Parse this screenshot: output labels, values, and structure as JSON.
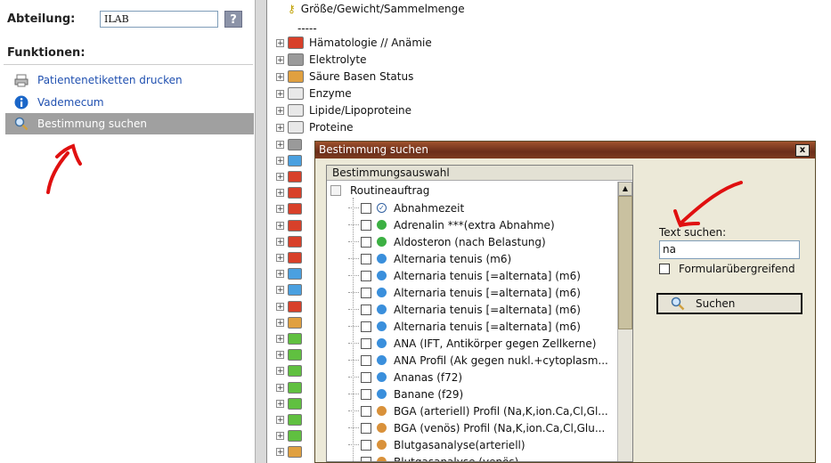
{
  "left_panel": {
    "abteilung_label": "Abteilung:",
    "abteilung_value": "ILAB",
    "help_label": "?",
    "funktionen_label": "Funktionen:",
    "items": [
      {
        "label": "Patientenetiketten drucken",
        "icon": "printer-icon"
      },
      {
        "label": "Vademecum",
        "icon": "info-icon"
      },
      {
        "label": "Bestimmung suchen",
        "icon": "search-icon",
        "active": true
      }
    ]
  },
  "tree": {
    "top_partial": "Größe/Gewicht/Sammelmenge",
    "dashes": "-----",
    "nodes": [
      {
        "label": "Hämatologie // Anämie",
        "color": "#d8402a"
      },
      {
        "label": "Elektrolyte",
        "color": "#9a9a9a"
      },
      {
        "label": "Säure Basen Status",
        "color": "#e0a040"
      },
      {
        "label": "Enzyme",
        "color": "#e8e8e8"
      },
      {
        "label": "Lipide/Lipoproteine",
        "color": "#e8e8e8"
      },
      {
        "label": "Proteine",
        "color": "#e8e8e8"
      }
    ],
    "side_icon_colors": [
      "#9a9a9a",
      "#4aa0e0",
      "#d8402a",
      "#d8402a",
      "#d8402a",
      "#d8402a",
      "#d8402a",
      "#d8402a",
      "#4aa0e0",
      "#4aa0e0",
      "#d8402a",
      "#e0a040",
      "#60c040",
      "#60c040",
      "#60c040",
      "#60c040",
      "#60c040",
      "#60c040",
      "#60c040",
      "#e0a040"
    ]
  },
  "dialog": {
    "title": "Bestimmung suchen",
    "close_label": "x",
    "list_header": "Bestimmungsauswahl",
    "root_label": "Routineauftrag",
    "rows": [
      {
        "label": "Abnahmezeit",
        "icon": "clock"
      },
      {
        "label": "Adrenalin ***(extra Abnahme)",
        "icon": "green"
      },
      {
        "label": "Aldosteron (nach Belastung)",
        "icon": "green"
      },
      {
        "label": "Alternaria tenuis (m6)",
        "icon": "blue"
      },
      {
        "label": "Alternaria tenuis [=alternata] (m6)",
        "icon": "blue"
      },
      {
        "label": "Alternaria tenuis [=alternata] (m6)",
        "icon": "blue"
      },
      {
        "label": "Alternaria tenuis [=alternata] (m6)",
        "icon": "blue"
      },
      {
        "label": "Alternaria tenuis [=alternata] (m6)",
        "icon": "blue"
      },
      {
        "label": "ANA (IFT, Antikörper gegen Zellkerne)",
        "icon": "blue"
      },
      {
        "label": "ANA Profil (Ak gegen nukl.+cytoplasm...",
        "icon": "blue"
      },
      {
        "label": "Ananas (f72)",
        "icon": "blue"
      },
      {
        "label": "Banane (f29)",
        "icon": "blue"
      },
      {
        "label": "BGA (arteriell) Profil (Na,K,ion.Ca,Cl,Gl...",
        "icon": "orange"
      },
      {
        "label": "BGA (venös) Profil (Na,K,ion.Ca,Cl,Glu...",
        "icon": "orange"
      },
      {
        "label": "Blutgasanalyse(arteriell)",
        "icon": "orange"
      },
      {
        "label": "Blutgasanalyse (venös)",
        "icon": "orange"
      }
    ],
    "text_suchen_label": "Text suchen:",
    "search_value": "na",
    "formular_label": "Formularübergreifend",
    "search_button_label": "Suchen"
  },
  "colors": {
    "green": "#3cb043",
    "blue": "#3a8fdc",
    "orange": "#d9913a",
    "active_item_bg": "#a0a0a0",
    "annotation": "#e01010"
  }
}
